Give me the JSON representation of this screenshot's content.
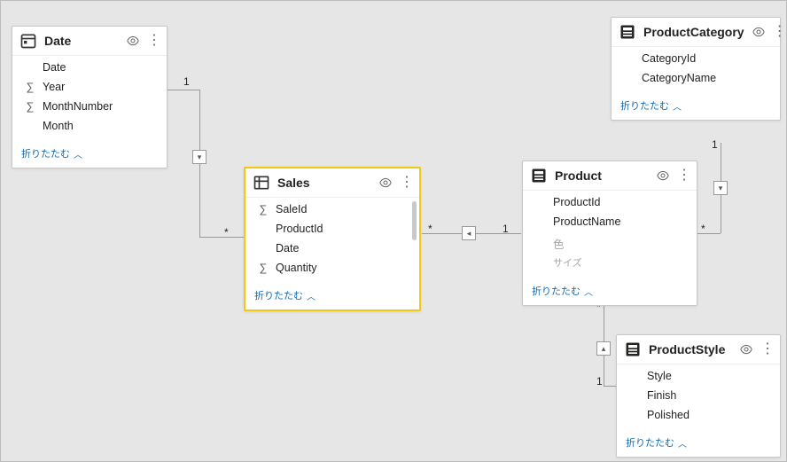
{
  "tables": {
    "date": {
      "title": "Date",
      "fields": [
        "Date",
        "Year",
        "MonthNumber",
        "Month"
      ],
      "sigma_idx": [
        1,
        2
      ],
      "collapse": "折りたたむ"
    },
    "sales": {
      "title": "Sales",
      "fields": [
        "SaleId",
        "ProductId",
        "Date",
        "Quantity"
      ],
      "sigma_idx": [
        0,
        3
      ],
      "collapse": "折りたたむ"
    },
    "product": {
      "title": "Product",
      "fields": [
        "ProductId",
        "ProductName"
      ],
      "faded": [
        "色",
        "サイズ"
      ],
      "collapse": "折りたたむ"
    },
    "category": {
      "title": "ProductCategory",
      "fields": [
        "CategoryId",
        "CategoryName"
      ],
      "collapse": "折りたたむ"
    },
    "style": {
      "title": "ProductStyle",
      "fields": [
        "Style",
        "Finish",
        "Polished"
      ],
      "collapse": "折りたたむ"
    }
  },
  "cardinality": {
    "one": "1",
    "many": "*"
  },
  "chart_data": {
    "type": "diagram",
    "entities": [
      {
        "name": "Date",
        "fields": [
          "Date",
          "Year",
          "MonthNumber",
          "Month"
        ]
      },
      {
        "name": "Sales",
        "fields": [
          "SaleId",
          "ProductId",
          "Date",
          "Quantity"
        ]
      },
      {
        "name": "Product",
        "fields": [
          "ProductId",
          "ProductName",
          "色",
          "サイズ"
        ]
      },
      {
        "name": "ProductCategory",
        "fields": [
          "CategoryId",
          "CategoryName"
        ]
      },
      {
        "name": "ProductStyle",
        "fields": [
          "Style",
          "Finish",
          "Polished"
        ]
      }
    ],
    "relationships": [
      {
        "from": "Date",
        "from_card": "1",
        "to": "Sales",
        "to_card": "*"
      },
      {
        "from": "Sales",
        "from_card": "*",
        "to": "Product",
        "to_card": "1"
      },
      {
        "from": "Product",
        "from_card": "*",
        "to": "ProductCategory",
        "to_card": "1"
      },
      {
        "from": "Product",
        "from_card": "*",
        "to": "ProductStyle",
        "to_card": "1"
      }
    ]
  }
}
